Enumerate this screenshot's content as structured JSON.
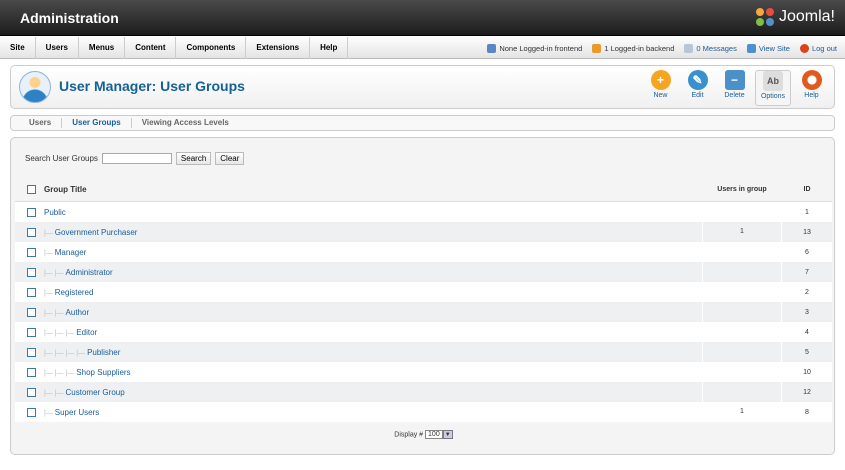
{
  "header": {
    "title": "Administration",
    "logo_text": "Joomla!"
  },
  "menu": [
    "Site",
    "Users",
    "Menus",
    "Content",
    "Components",
    "Extensions",
    "Help"
  ],
  "status": {
    "frontend": "None Logged-in frontend",
    "backend": "1 Logged-in backend",
    "messages": "0 Messages",
    "view_site": "View Site",
    "logout": "Log out"
  },
  "toolbar": {
    "page_title": "User Manager: User Groups",
    "buttons": [
      "New",
      "Edit",
      "Delete",
      "Options",
      "Help"
    ]
  },
  "subtabs": [
    "Users",
    "User Groups",
    "Viewing Access Levels"
  ],
  "search": {
    "label": "Search User Groups",
    "search_button": "Search",
    "clear_button": "Clear",
    "value": ""
  },
  "table": {
    "headers": {
      "title": "Group Title",
      "users": "Users in group",
      "id": "ID"
    },
    "rows": [
      {
        "tree": "",
        "title": "Public",
        "users": "",
        "id": "1"
      },
      {
        "tree": "|— ",
        "title": "Government Purchaser",
        "users": "1",
        "id": "13"
      },
      {
        "tree": "|— ",
        "title": "Manager",
        "users": "",
        "id": "6"
      },
      {
        "tree": "|— |— ",
        "title": "Administrator",
        "users": "",
        "id": "7"
      },
      {
        "tree": "|— ",
        "title": "Registered",
        "users": "",
        "id": "2"
      },
      {
        "tree": "|— |— ",
        "title": "Author",
        "users": "",
        "id": "3"
      },
      {
        "tree": "|— |— |— ",
        "title": "Editor",
        "users": "",
        "id": "4"
      },
      {
        "tree": "|— |— |— |— ",
        "title": "Publisher",
        "users": "",
        "id": "5"
      },
      {
        "tree": "|— |— |— ",
        "title": "Shop Suppliers",
        "users": "",
        "id": "10"
      },
      {
        "tree": "|— |— ",
        "title": "Customer Group",
        "users": "",
        "id": "12"
      },
      {
        "tree": "|— ",
        "title": "Super Users",
        "users": "1",
        "id": "8"
      }
    ]
  },
  "pagination": {
    "label": "Display #",
    "value": "100"
  },
  "colors": {
    "accent": "#146295",
    "link": "#1a5c99",
    "header_bg": "#2b2b2b"
  }
}
